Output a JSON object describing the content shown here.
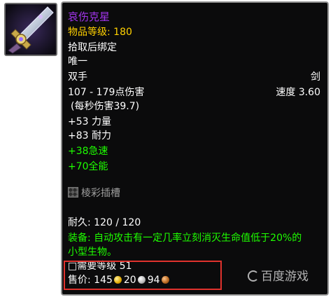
{
  "item": {
    "name": "哀伤克星",
    "item_level": "物品等级: 180",
    "binding": "拾取后绑定",
    "unique": "唯一",
    "slot": "双手",
    "weapon_type": "剑",
    "damage": "107 - 179点伤害",
    "speed": "速度 3.60",
    "dps": "(每秒伤害39.7)",
    "stat_strength": "+53 力量",
    "stat_stamina": "+83 耐力",
    "stat_haste": "+38急速",
    "stat_versatility": "+70全能",
    "socket": "棱彩插槽",
    "durability": "耐久: 120 / 120",
    "equip_line1": "装备: 自动攻击有一定几率立刻消灭生命值低于20%的",
    "equip_line2": "小型生物。",
    "required_level": "□需要等级 51",
    "sell_label": "售价: 145",
    "sell_silver": "20",
    "sell_copper": "94"
  },
  "icons": {
    "item_icon": "sword-icon",
    "socket_icon": "prismatic-socket-icon",
    "gold_icon": "gold-coin-icon",
    "silver_icon": "silver-coin-icon",
    "copper_icon": "copper-coin-icon"
  },
  "colors": {
    "epic": "#a335ee",
    "item_level": "#ffd100",
    "green_text": "#1eff00",
    "highlight": "#e0322d"
  },
  "watermark": {
    "text": "百度游戏"
  }
}
